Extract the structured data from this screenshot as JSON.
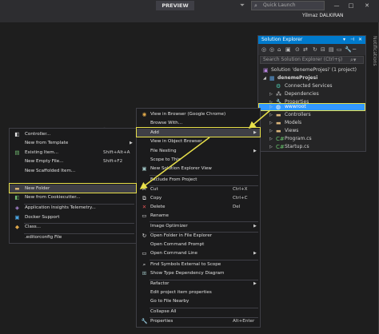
{
  "topbar": {
    "preview_label": "PREVIEW",
    "search_placeholder": "Quick Launch",
    "user_name": "Yilmaz DALKIRAN",
    "minimize_glyph": "—",
    "maximize_glyph": "□",
    "close_glyph": "✕"
  },
  "notifications_label": "Notifications",
  "solution_explorer": {
    "title": "Solution Explorer",
    "search_placeholder": "Search Solution Explorer (Ctrl+ş)",
    "tree": [
      {
        "label": "Solution 'denemeProjesi' (1 project)",
        "icon": "solution-icon"
      },
      {
        "label": "denemeProjesi",
        "icon": "project-icon"
      },
      {
        "label": "Connected Services",
        "icon": "connected-services-icon"
      },
      {
        "label": "Dependencies",
        "icon": "dependencies-icon"
      },
      {
        "label": "Properties",
        "icon": "properties-icon"
      },
      {
        "label": "wwwroot",
        "icon": "globe-icon"
      },
      {
        "label": "Controllers",
        "icon": "folder-icon"
      },
      {
        "label": "Models",
        "icon": "folder-icon"
      },
      {
        "label": "Views",
        "icon": "folder-icon"
      },
      {
        "label": "Program.cs",
        "icon": "csharp-file-icon"
      },
      {
        "label": "Startup.cs",
        "icon": "csharp-file-icon"
      }
    ]
  },
  "context_menu": {
    "items": [
      {
        "label": "View in Browser (Google Chrome)",
        "shortcut": ""
      },
      {
        "label": "Browse With...",
        "shortcut": ""
      },
      {
        "label": "Add",
        "shortcut": ""
      },
      {
        "label": "View in Object Browser",
        "shortcut": ""
      },
      {
        "label": "File Nesting",
        "shortcut": ""
      },
      {
        "label": "Scope to This",
        "shortcut": ""
      },
      {
        "label": "New Solution Explorer View",
        "shortcut": ""
      },
      {
        "label": "Exclude From Project",
        "shortcut": ""
      },
      {
        "label": "Cut",
        "shortcut": "Ctrl+X"
      },
      {
        "label": "Copy",
        "shortcut": "Ctrl+C"
      },
      {
        "label": "Delete",
        "shortcut": "Del"
      },
      {
        "label": "Rename",
        "shortcut": ""
      },
      {
        "label": "Image Optimizer",
        "shortcut": ""
      },
      {
        "label": "Open Folder in File Explorer",
        "shortcut": ""
      },
      {
        "label": "Open Command Prompt",
        "shortcut": ""
      },
      {
        "label": "Open Command Line",
        "shortcut": ""
      },
      {
        "label": "Find Symbols External to Scope",
        "shortcut": ""
      },
      {
        "label": "Show Type Dependency Diagram",
        "shortcut": ""
      },
      {
        "label": "Refactor",
        "shortcut": ""
      },
      {
        "label": "Edit project item properties",
        "shortcut": ""
      },
      {
        "label": "Go to File Nearby",
        "shortcut": ""
      },
      {
        "label": "Collapse All",
        "shortcut": ""
      },
      {
        "label": "Properties",
        "shortcut": "Alt+Enter"
      }
    ]
  },
  "add_submenu": {
    "items": [
      {
        "label": "Controller...",
        "shortcut": ""
      },
      {
        "label": "New from Template",
        "shortcut": ""
      },
      {
        "label": "Existing Item...",
        "shortcut": "Shift+Alt+A"
      },
      {
        "label": "New Empty File...",
        "shortcut": "Shift+F2"
      },
      {
        "label": "New Scaffolded Item...",
        "shortcut": ""
      },
      {
        "label": "New Folder",
        "shortcut": ""
      },
      {
        "label": "New from Cookiecutter...",
        "shortcut": ""
      },
      {
        "label": "Application Insights Telemetry...",
        "shortcut": ""
      },
      {
        "label": "Docker Support",
        "shortcut": ""
      },
      {
        "label": "Class...",
        "shortcut": ""
      },
      {
        "label": ".editorconfig File",
        "shortcut": ""
      }
    ]
  },
  "colors": {
    "accent": "#007acc",
    "selection": "#3399ff",
    "highlight_box": "#e8e04a",
    "background": "#1e1e1e",
    "menu_background": "#1b1b1c"
  }
}
